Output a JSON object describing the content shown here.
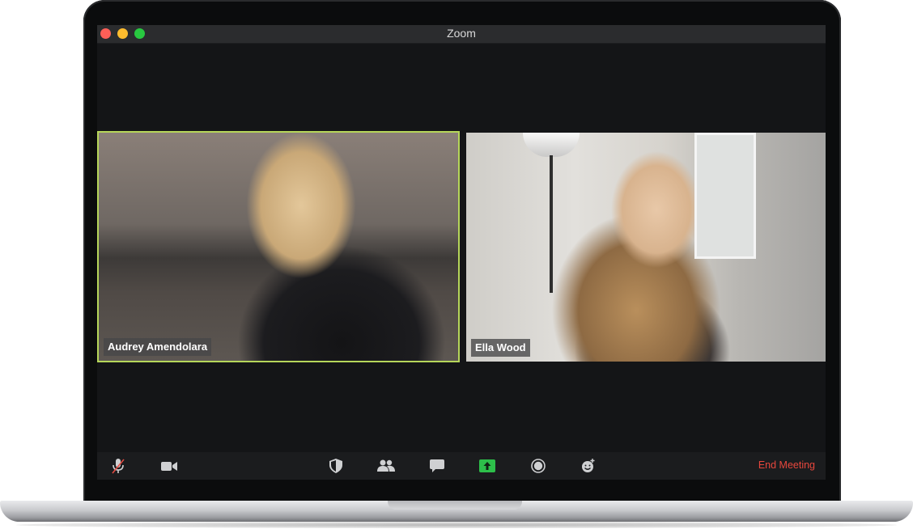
{
  "window": {
    "title": "Zoom"
  },
  "participants": [
    {
      "name": "Audrey Amendolara",
      "active_speaker": true
    },
    {
      "name": "Ella Wood",
      "active_speaker": false
    }
  ],
  "toolbar": {
    "buttons": [
      {
        "id": "mute",
        "icon": "microphone-muted-icon"
      },
      {
        "id": "video",
        "icon": "video-camera-icon"
      },
      {
        "id": "security",
        "icon": "shield-icon"
      },
      {
        "id": "participants",
        "icon": "participants-icon"
      },
      {
        "id": "chat",
        "icon": "chat-icon"
      },
      {
        "id": "share-screen",
        "icon": "share-screen-icon"
      },
      {
        "id": "record",
        "icon": "record-icon"
      },
      {
        "id": "reactions",
        "icon": "reaction-emoji-icon"
      }
    ],
    "end_label": "End Meeting"
  },
  "colors": {
    "active_speaker_border": "#b6d65a",
    "share_accent": "#2dbf4a",
    "end_meeting": "#e8473d"
  }
}
